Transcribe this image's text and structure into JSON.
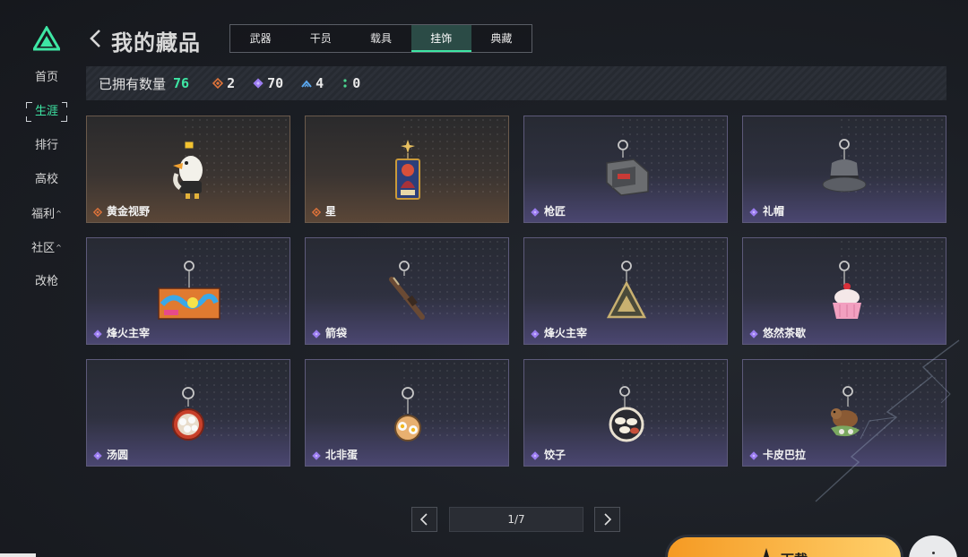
{
  "brand": {
    "logo_icon": "triangle-logo-icon",
    "accent": "#3ee6a4"
  },
  "sidebar": {
    "items": [
      {
        "label": "首页",
        "active": false,
        "caret": ""
      },
      {
        "label": "生涯",
        "active": true,
        "caret": ""
      },
      {
        "label": "排行",
        "active": false,
        "caret": ""
      },
      {
        "label": "高校",
        "active": false,
        "caret": ""
      },
      {
        "label": "福利",
        "active": false,
        "caret": "^"
      },
      {
        "label": "社区",
        "active": false,
        "caret": "^"
      },
      {
        "label": "改枪",
        "active": false,
        "caret": ""
      }
    ]
  },
  "header": {
    "title": "我的藏品",
    "tabs": [
      {
        "label": "武器",
        "active": false
      },
      {
        "label": "干员",
        "active": false
      },
      {
        "label": "载具",
        "active": false
      },
      {
        "label": "挂饰",
        "active": true
      },
      {
        "label": "典藏",
        "active": false
      }
    ]
  },
  "stats": {
    "owned_label": "已拥有数量",
    "owned_count": "76",
    "rarity_counts": [
      {
        "icon": "gold-diamond-icon",
        "color": "#e0743a",
        "count": "2"
      },
      {
        "icon": "purple-diamond-icon",
        "color": "#9b7cf0",
        "count": "70"
      },
      {
        "icon": "blue-chevron-icon",
        "color": "#5aa8f0",
        "count": "4"
      },
      {
        "icon": "green-dots-icon",
        "color": "#4bd68f",
        "count": "0"
      }
    ]
  },
  "items": [
    {
      "name": "黄金视野",
      "rarity": "gold",
      "icon": "eagle-keychain-icon"
    },
    {
      "name": "星",
      "rarity": "gold",
      "icon": "star-card-keychain-icon"
    },
    {
      "name": "枪匠",
      "rarity": "purple",
      "icon": "gunsmith-box-keychain-icon"
    },
    {
      "name": "礼帽",
      "rarity": "purple",
      "icon": "top-hat-keychain-icon"
    },
    {
      "name": "烽火主宰",
      "rarity": "purple",
      "icon": "graffiti-sign-keychain-icon"
    },
    {
      "name": "箭袋",
      "rarity": "purple",
      "icon": "quiver-keychain-icon"
    },
    {
      "name": "烽火主宰",
      "rarity": "purple",
      "icon": "triangle-emblem-keychain-icon"
    },
    {
      "name": "悠然茶歇",
      "rarity": "purple",
      "icon": "cupcake-keychain-icon"
    },
    {
      "name": "汤圆",
      "rarity": "purple",
      "icon": "tangyuan-bowl-keychain-icon"
    },
    {
      "name": "北非蛋",
      "rarity": "purple",
      "icon": "shakshuka-pan-keychain-icon"
    },
    {
      "name": "饺子",
      "rarity": "purple",
      "icon": "dumpling-plate-keychain-icon"
    },
    {
      "name": "卡皮巴拉",
      "rarity": "purple",
      "icon": "capybara-keychain-icon"
    }
  ],
  "pager": {
    "indicator": "1/7"
  },
  "footer": {
    "download_label": "下载"
  }
}
